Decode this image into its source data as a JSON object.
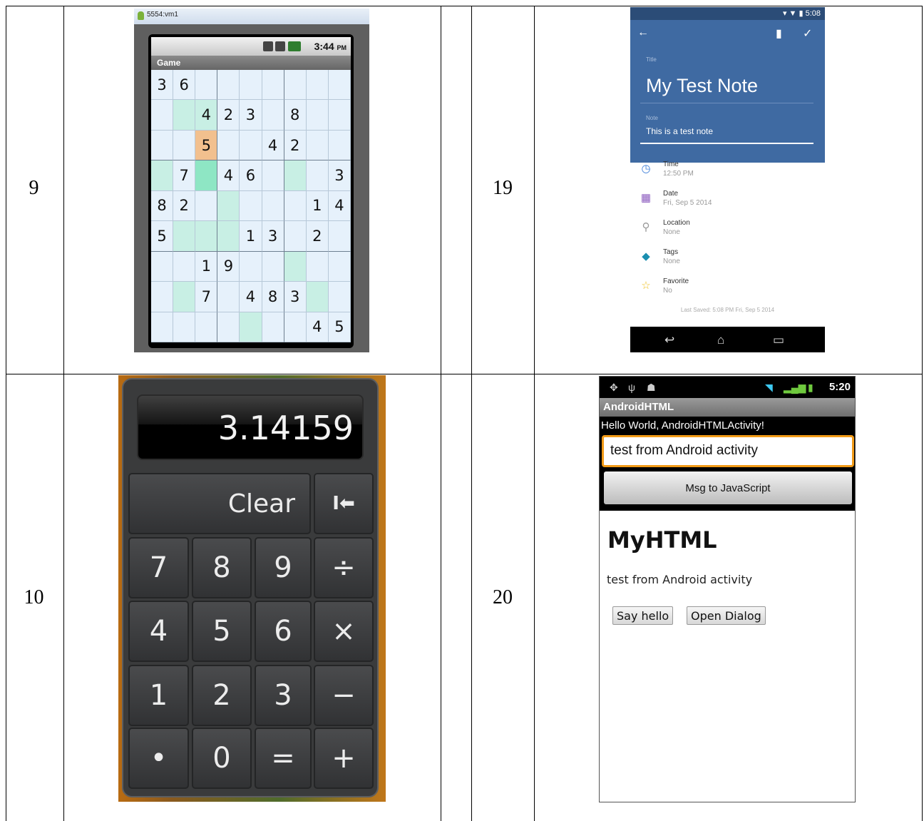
{
  "table": {
    "row_numbers": [
      "9",
      "19",
      "10",
      "20"
    ]
  },
  "sudoku": {
    "window_title": "5554:vm1",
    "status_time": "3:44",
    "status_ampm": "PM",
    "app_title": "Game",
    "grid": [
      [
        "3",
        "6",
        "",
        "",
        "",
        "",
        "",
        "",
        ""
      ],
      [
        "",
        "",
        "4",
        "2",
        "3",
        "",
        "8",
        "",
        ""
      ],
      [
        "",
        "",
        "5",
        "",
        "",
        "4",
        "2",
        "",
        ""
      ],
      [
        "",
        "7",
        "",
        "4",
        "6",
        "",
        "",
        "",
        "3"
      ],
      [
        "8",
        "2",
        "",
        "",
        "",
        "",
        "",
        "1",
        "4"
      ],
      [
        "5",
        "",
        "",
        "",
        "1",
        "3",
        "",
        "2",
        ""
      ],
      [
        "",
        "",
        "1",
        "9",
        "",
        "",
        "",
        "",
        ""
      ],
      [
        "",
        "",
        "7",
        "",
        "4",
        "8",
        "3",
        "",
        ""
      ],
      [
        "",
        "",
        "",
        "",
        "",
        "",
        "",
        "4",
        "5"
      ]
    ]
  },
  "note": {
    "status_time": "5:08",
    "title_label": "Title",
    "title_value": "My Test Note",
    "note_label": "Note",
    "note_value": "This is a test note",
    "fields": [
      {
        "label": "Time",
        "value": "12:50 PM",
        "icon": "clock-icon"
      },
      {
        "label": "Date",
        "value": "Fri, Sep 5 2014",
        "icon": "calendar-icon"
      },
      {
        "label": "Location",
        "value": "None",
        "icon": "location-pin-icon"
      },
      {
        "label": "Tags",
        "value": "None",
        "icon": "tag-icon"
      },
      {
        "label": "Favorite",
        "value": "No",
        "icon": "star-icon"
      }
    ],
    "last_saved": "Last Saved: 5:08 PM Fri, Sep 5 2014"
  },
  "calculator": {
    "display": "3.14159",
    "clear_label": "Clear",
    "backspace_label": "I⬅",
    "keys": [
      "7",
      "8",
      "9",
      "÷",
      "4",
      "5",
      "6",
      "×",
      "1",
      "2",
      "3",
      "−",
      "•",
      "0",
      "=",
      "+"
    ]
  },
  "androidhtml": {
    "status_time": "5:20",
    "app_title": "AndroidHTML",
    "hello_text": "Hello World, AndroidHTMLActivity!",
    "input_value": "test from Android activity",
    "msg_button": "Msg to JavaScript",
    "web_heading": "MyHTML",
    "web_text": "test from Android activity",
    "say_hello": "Say hello",
    "open_dialog": "Open Dialog"
  },
  "colors": {
    "note_header": "#3f6aa2",
    "input_focus": "#f29b17",
    "sudoku_selected": "#f2c08e",
    "sudoku_highlight": "#c8efe4"
  }
}
